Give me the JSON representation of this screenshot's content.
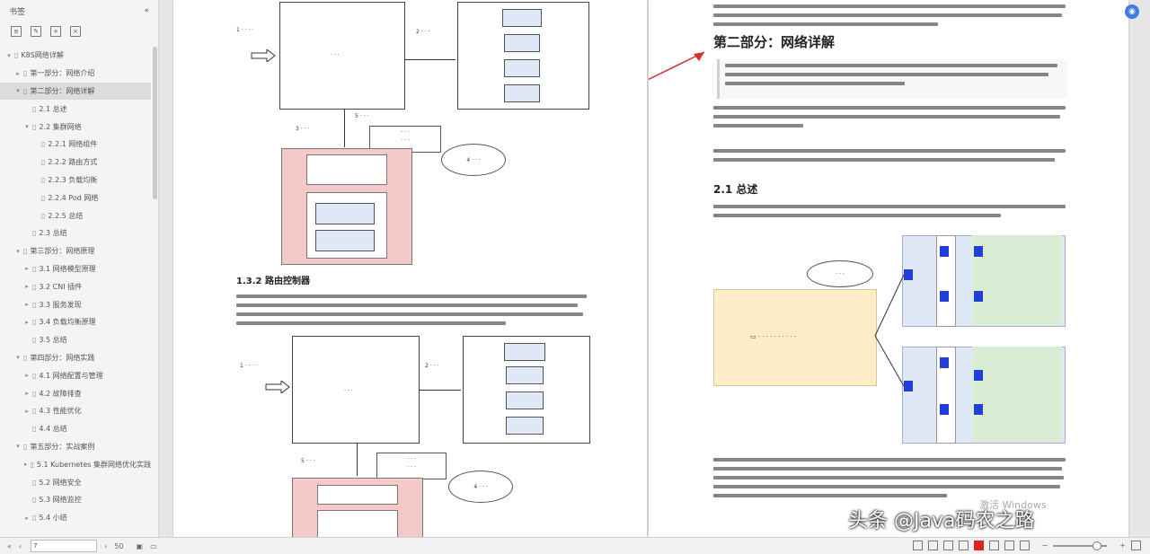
{
  "sidebar": {
    "header": "书签",
    "toc": [
      {
        "label": "K8S网络详解",
        "level": 0,
        "arrow": "▾"
      },
      {
        "label": "第一部分：网络介绍",
        "level": 1,
        "arrow": "▸"
      },
      {
        "label": "第二部分：网络详解",
        "level": 1,
        "arrow": "▾",
        "active": true
      },
      {
        "label": "2.1 总述",
        "level": 2,
        "arrow": ""
      },
      {
        "label": "2.2 集群网络",
        "level": 2,
        "arrow": "▾"
      },
      {
        "label": "2.2.1 网络组件",
        "level": 3,
        "arrow": ""
      },
      {
        "label": "2.2.2 路由方式",
        "level": 3,
        "arrow": ""
      },
      {
        "label": "2.2.3 负载均衡",
        "level": 3,
        "arrow": ""
      },
      {
        "label": "2.2.4 Pod 网络",
        "level": 3,
        "arrow": ""
      },
      {
        "label": "2.2.5 总结",
        "level": 3,
        "arrow": ""
      },
      {
        "label": "2.3 总结",
        "level": 2,
        "arrow": ""
      },
      {
        "label": "第三部分：网络原理",
        "level": 1,
        "arrow": "▾"
      },
      {
        "label": "3.1 网络模型原理",
        "level": 2,
        "arrow": "▸"
      },
      {
        "label": "3.2 CNI 插件",
        "level": 2,
        "arrow": "▸"
      },
      {
        "label": "3.3 服务发现",
        "level": 2,
        "arrow": "▸"
      },
      {
        "label": "3.4 负载均衡原理",
        "level": 2,
        "arrow": "▸"
      },
      {
        "label": "3.5 总结",
        "level": 2,
        "arrow": ""
      },
      {
        "label": "第四部分：网络实践",
        "level": 1,
        "arrow": "▾"
      },
      {
        "label": "4.1 网络配置与管理",
        "level": 2,
        "arrow": "▸"
      },
      {
        "label": "4.2 故障排查",
        "level": 2,
        "arrow": "▸"
      },
      {
        "label": "4.3 性能优化",
        "level": 2,
        "arrow": "▸"
      },
      {
        "label": "4.4 总结",
        "level": 2,
        "arrow": ""
      },
      {
        "label": "第五部分：实战案例",
        "level": 1,
        "arrow": "▾"
      },
      {
        "label": "5.1 Kubernetes 集群网络优化实践",
        "level": 2,
        "arrow": "▸"
      },
      {
        "label": "5.2 网络安全",
        "level": 2,
        "arrow": ""
      },
      {
        "label": "5.3 网络监控",
        "level": 2,
        "arrow": ""
      },
      {
        "label": "5.4 小结",
        "level": 2,
        "arrow": "▸"
      }
    ]
  },
  "left_page": {
    "heading_132": "1.3.2 路由控制器"
  },
  "right_page": {
    "part2_title": "第二部分：网络详解",
    "section_21": "2.1 总述"
  },
  "status": {
    "page_number": "7",
    "total": "50"
  },
  "watermark": "头条 @Java码农之路",
  "windows_activate": "激活 Windows",
  "colors": {
    "accent_red": "#d32f2f",
    "diagram_pink": "#f6c9c9",
    "diagram_blue": "#dfe8f6"
  }
}
